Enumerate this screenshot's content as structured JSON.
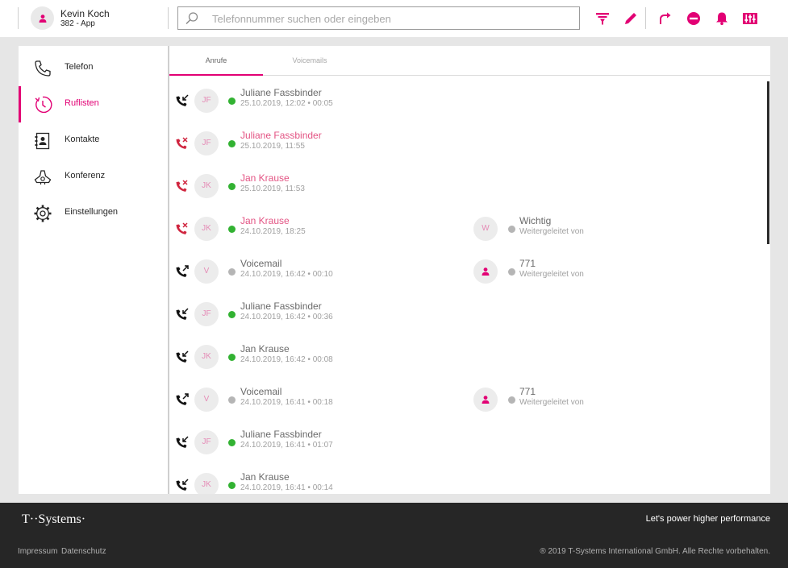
{
  "colors": {
    "accent": "#e20074",
    "missed": "#e35383",
    "online": "#32b232",
    "offline": "#b5b5b5",
    "footer_bg": "#262626"
  },
  "header": {
    "user": {
      "name": "Kevin Koch",
      "subtitle": "382 - App",
      "icon": "person-icon"
    },
    "search": {
      "placeholder": "Telefonnummer suchen oder eingeben",
      "value": ""
    },
    "actions": [
      {
        "name": "filter-icon"
      },
      {
        "name": "pencil-icon"
      },
      {
        "name": "call-forward-icon"
      },
      {
        "name": "do-not-disturb-icon"
      },
      {
        "name": "bell-icon"
      },
      {
        "name": "equalizer-icon"
      }
    ]
  },
  "sidebar": {
    "items": [
      {
        "label": "Telefon",
        "icon": "phone-icon",
        "active": false
      },
      {
        "label": "Ruflisten",
        "icon": "history-clock-icon",
        "active": true
      },
      {
        "label": "Kontakte",
        "icon": "contacts-book-icon",
        "active": false
      },
      {
        "label": "Konferenz",
        "icon": "conference-phone-icon",
        "active": false
      },
      {
        "label": "Einstellungen",
        "icon": "gear-icon",
        "active": false
      }
    ]
  },
  "tabs": [
    {
      "label": "Anrufe",
      "active": true
    },
    {
      "label": "Voicemails",
      "active": false
    }
  ],
  "calls": [
    {
      "direction": "incoming",
      "initials": "JF",
      "status": "online",
      "name": "Juliane Fassbinder",
      "time": "25.10.2019, 12:02 • 00:05",
      "missed": false,
      "forward": null
    },
    {
      "direction": "missed",
      "initials": "JF",
      "status": "online",
      "name": "Juliane Fassbinder",
      "time": "25.10.2019, 11:55",
      "missed": true,
      "forward": null
    },
    {
      "direction": "missed",
      "initials": "JK",
      "status": "online",
      "name": "Jan Krause",
      "time": "25.10.2019, 11:53",
      "missed": true,
      "forward": null
    },
    {
      "direction": "missed",
      "initials": "JK",
      "status": "online",
      "name": "Jan Krause",
      "time": "24.10.2019, 18:25",
      "missed": true,
      "forward": {
        "avatar": "W",
        "name": "Wichtig",
        "label": "Weitergeleitet von"
      }
    },
    {
      "direction": "outgoing",
      "initials": "V",
      "status": "offline",
      "name": "Voicemail",
      "time": "24.10.2019, 16:42 • 00:10",
      "missed": false,
      "forward": {
        "avatar": "person-icon",
        "name": "771",
        "label": "Weitergeleitet von"
      }
    },
    {
      "direction": "incoming",
      "initials": "JF",
      "status": "online",
      "name": "Juliane Fassbinder",
      "time": "24.10.2019, 16:42 • 00:36",
      "missed": false,
      "forward": null
    },
    {
      "direction": "incoming",
      "initials": "JK",
      "status": "online",
      "name": "Jan Krause",
      "time": "24.10.2019, 16:42 • 00:08",
      "missed": false,
      "forward": null
    },
    {
      "direction": "outgoing",
      "initials": "V",
      "status": "offline",
      "name": "Voicemail",
      "time": "24.10.2019, 16:41 • 00:18",
      "missed": false,
      "forward": {
        "avatar": "person-icon",
        "name": "771",
        "label": "Weitergeleitet von"
      }
    },
    {
      "direction": "incoming",
      "initials": "JF",
      "status": "online",
      "name": "Juliane Fassbinder",
      "time": "24.10.2019, 16:41 • 01:07",
      "missed": false,
      "forward": null
    },
    {
      "direction": "incoming",
      "initials": "JK",
      "status": "online",
      "name": "Jan Krause",
      "time": "24.10.2019, 16:41 • 00:14",
      "missed": false,
      "forward": null
    }
  ],
  "footer": {
    "brand": "T··Systems·",
    "tagline": "Let's power higher performance",
    "links": [
      "Impressum",
      "Datenschutz"
    ],
    "copyright": "® 2019 T-Systems International GmbH. Alle Rechte vorbehalten."
  }
}
